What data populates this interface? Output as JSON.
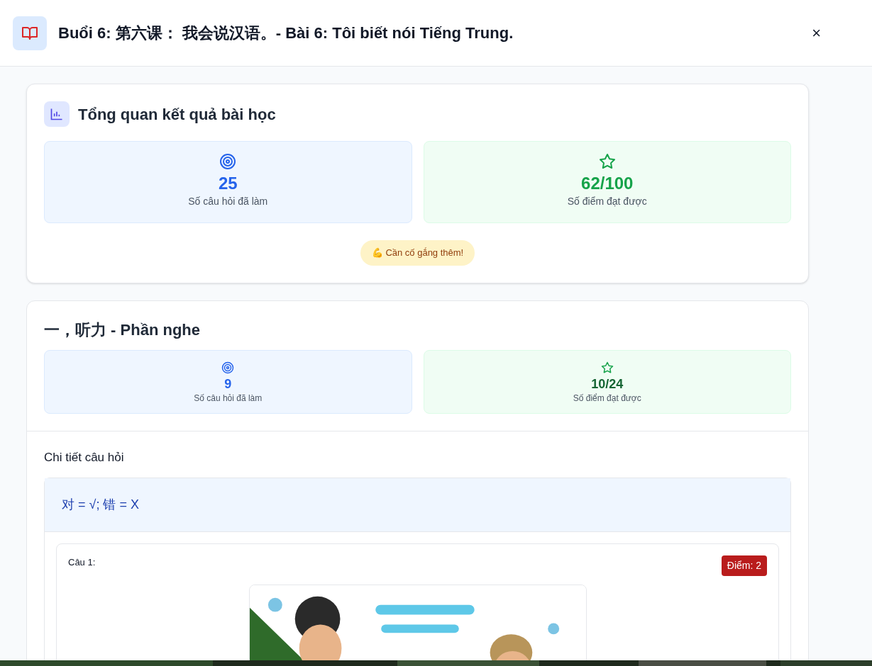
{
  "dialog": {
    "title": "Buổi 6: 第六课： 我会说汉语。- Bài 6: Tôi biết nói Tiếng Trung.",
    "close": "×"
  },
  "overview": {
    "title": "Tổng quan kết quả bài học",
    "stats": [
      {
        "kind": "questions",
        "value": "25",
        "label": "Số câu hỏi đã làm"
      },
      {
        "kind": "score",
        "value": "62/100",
        "label": "Số điểm đạt được"
      }
    ],
    "feedback": "💪 Cần cố gắng thêm!"
  },
  "section": {
    "title": "一，听力 - Phần nghe",
    "stats": [
      {
        "kind": "questions",
        "value": "9",
        "label": "Số câu hỏi đã làm"
      },
      {
        "kind": "score",
        "value": "10/24",
        "label": "Số điểm đạt được"
      }
    ],
    "details_title": "Chi tiết câu hỏi",
    "instruction": "对 = √; 错 = X",
    "questions": [
      {
        "label": "Câu 1:",
        "score": "Điểm: 2"
      }
    ]
  }
}
